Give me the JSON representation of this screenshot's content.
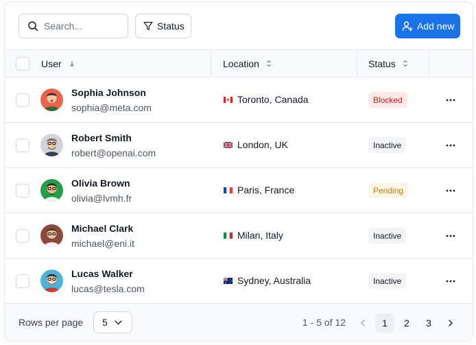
{
  "toolbar": {
    "search_placeholder": "Search...",
    "search_value": "",
    "status_filter_label": "Status",
    "add_new_label": "Add new",
    "accent_color": "#1a73e8"
  },
  "table": {
    "columns": [
      {
        "label": "User",
        "sort_icon": "arrow-down-icon"
      },
      {
        "label": "Location",
        "sort_icon": "sort-updown-icon"
      },
      {
        "label": "Status",
        "sort_icon": "sort-updown-icon"
      }
    ],
    "rows": [
      {
        "name": "Sophia Johnson",
        "email": "sophia@meta.com",
        "flag": "flag-canada",
        "location": "Toronto, Canada",
        "status": "Blocked",
        "status_kind": "blocked",
        "avatar_color": "#c0392b"
      },
      {
        "name": "Robert Smith",
        "email": "robert@openai.com",
        "flag": "flag-uk",
        "location": "London, UK",
        "status": "Inactive",
        "status_kind": "inactive",
        "avatar_color": "#9ca3af"
      },
      {
        "name": "Olivia Brown",
        "email": "olivia@lvmh.fr",
        "flag": "flag-france",
        "location": "Paris, France",
        "status": "Pending",
        "status_kind": "pending",
        "avatar_color": "#22a04b"
      },
      {
        "name": "Michael Clark",
        "email": "michael@eni.it",
        "flag": "flag-italy",
        "location": "Milan, Italy",
        "status": "Inactive",
        "status_kind": "inactive",
        "avatar_color": "#8b4a3c"
      },
      {
        "name": "Lucas Walker",
        "email": "lucas@tesla.com",
        "flag": "flag-australia",
        "location": "Sydney, Australia",
        "status": "Inactive",
        "status_kind": "inactive",
        "avatar_color": "#4fb3d9"
      }
    ]
  },
  "footer": {
    "rows_per_page_label": "Rows per page",
    "rows_per_page_value": "5",
    "range_text": "1 - 5 of 12",
    "pages": [
      "1",
      "2",
      "3"
    ],
    "current_page": "1"
  },
  "status_colors": {
    "blocked_bg": "#fde8e8",
    "blocked_text": "#c81e1e",
    "inactive_bg": "#f3f4f6",
    "inactive_text": "#111827",
    "pending_bg": "#fef6e4",
    "pending_text": "#b7791f"
  }
}
